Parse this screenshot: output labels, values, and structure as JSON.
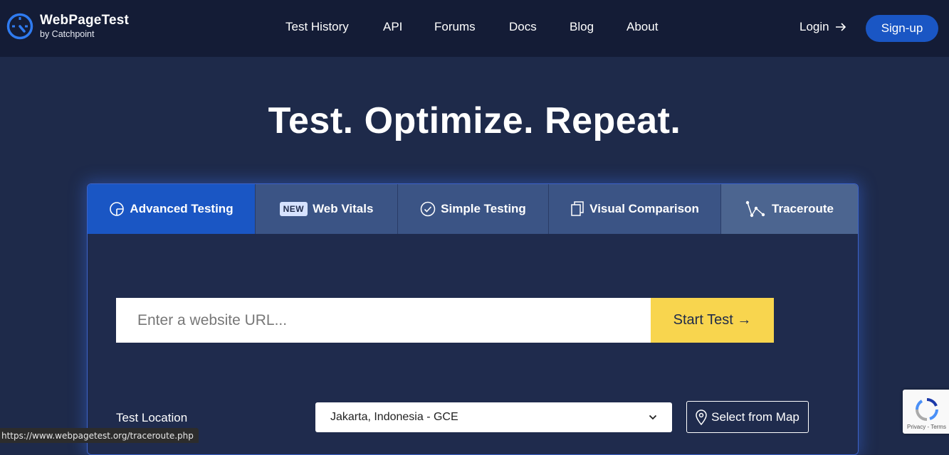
{
  "header": {
    "brand_title": "WebPageTest",
    "brand_subtitle": "by Catchpoint",
    "nav": [
      {
        "label": "Test History"
      },
      {
        "label": "API"
      },
      {
        "label": "Forums"
      },
      {
        "label": "Docs"
      },
      {
        "label": "Blog"
      },
      {
        "label": "About"
      }
    ],
    "login_label": "Login",
    "signup_label": "Sign-up"
  },
  "hero": {
    "title": "Test. Optimize. Repeat."
  },
  "tabs": [
    {
      "label": "Advanced Testing",
      "icon": "gauge-icon"
    },
    {
      "label": "Web Vitals",
      "badge": "NEW"
    },
    {
      "label": "Simple Testing",
      "icon": "check-circle-icon"
    },
    {
      "label": "Visual Comparison",
      "icon": "documents-icon"
    },
    {
      "label": "Traceroute",
      "icon": "route-icon"
    }
  ],
  "form": {
    "url_placeholder": "Enter a website URL...",
    "start_label": "Start Test →",
    "location_label": "Test Location",
    "location_value": "Jakarta, Indonesia - GCE",
    "map_label": "Select from Map"
  },
  "status_bar": {
    "url": "https://www.webpagetest.org/traceroute.php"
  },
  "recaptcha": {
    "terms": "Privacy - Terms"
  },
  "colors": {
    "background": "#1e2a4a",
    "header": "#141c36",
    "accent": "#1a56c4",
    "start_button": "#f8d54e"
  }
}
